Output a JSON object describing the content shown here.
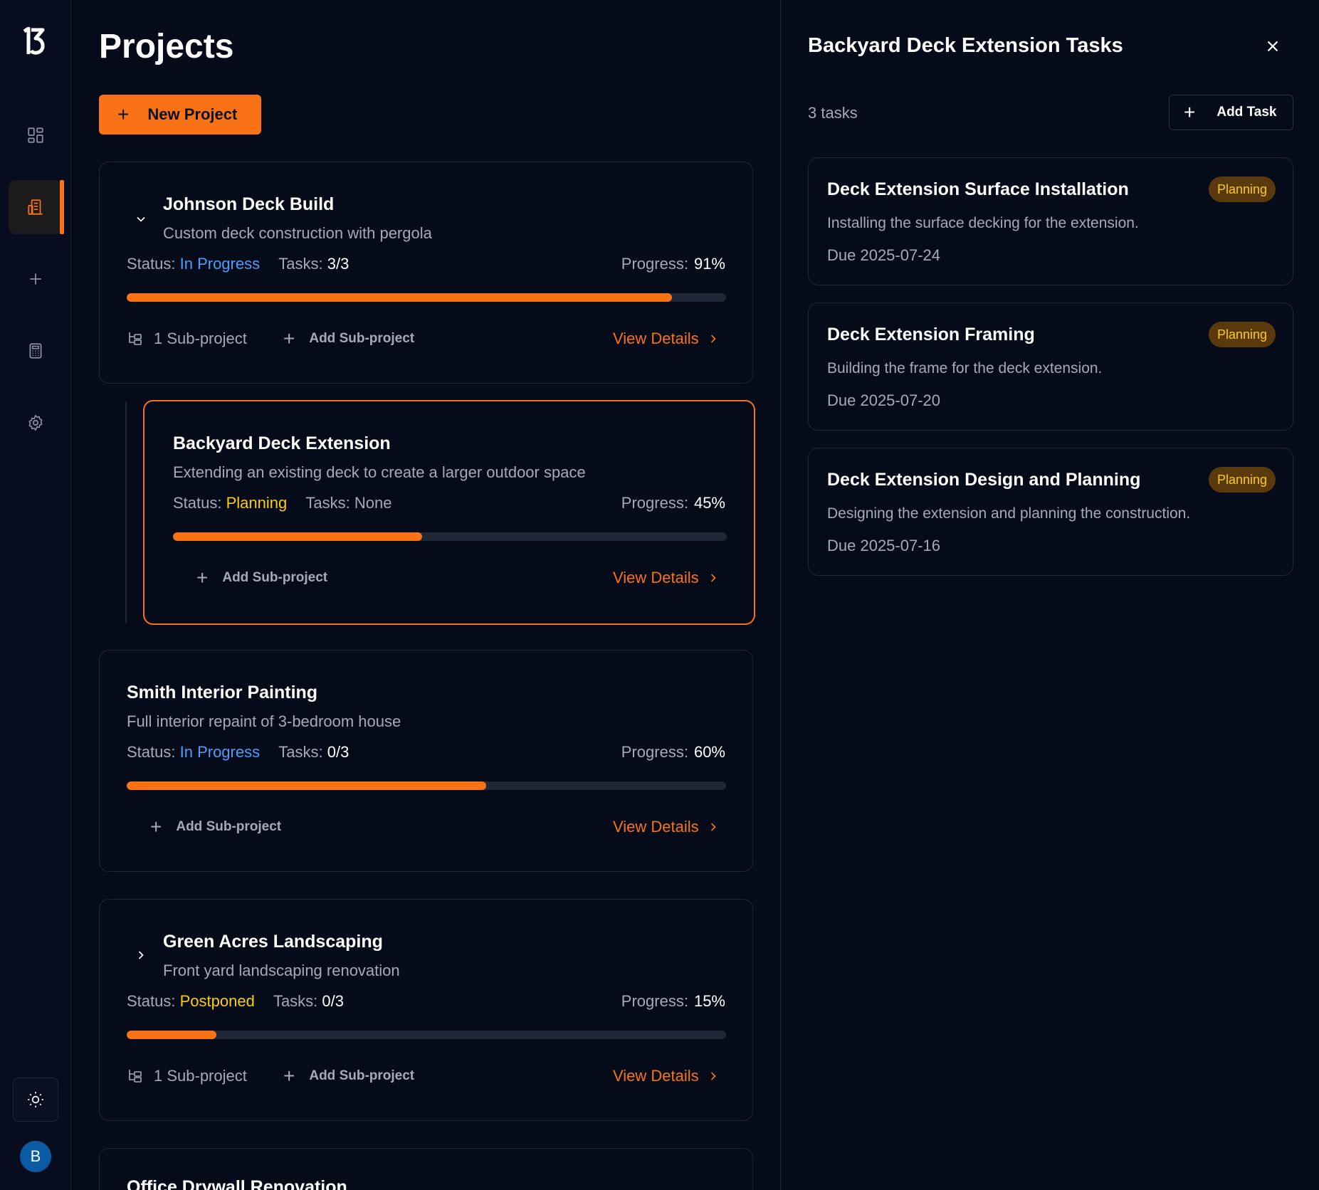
{
  "sidebar": {
    "logo": "B",
    "avatar": "B"
  },
  "main": {
    "title": "Projects",
    "new_project_label": "New Project",
    "projects": [
      {
        "title": "Johnson Deck Build",
        "description": "Custom deck construction with pergola",
        "status_label": "Status:",
        "status": "In Progress",
        "tasks_label": "Tasks:",
        "tasks": "3/3",
        "progress_label": "Progress:",
        "progress": "91%",
        "progress_value": 0.91,
        "sub_count": "1 Sub-project",
        "add_sub": "Add Sub-project",
        "view_details": "View Details"
      },
      {
        "title": "Backyard Deck Extension",
        "description": "Extending an existing deck to create a larger outdoor space",
        "status_label": "Status:",
        "status": "Planning",
        "tasks_label": "Tasks:",
        "tasks": "None",
        "progress_label": "Progress:",
        "progress": "45%",
        "progress_value": 0.45,
        "add_sub": "Add Sub-project",
        "view_details": "View Details"
      },
      {
        "title": "Smith Interior Painting",
        "description": "Full interior repaint of 3-bedroom house",
        "status_label": "Status:",
        "status": "In Progress",
        "tasks_label": "Tasks:",
        "tasks": "0/3",
        "progress_label": "Progress:",
        "progress": "60%",
        "progress_value": 0.6,
        "add_sub": "Add Sub-project",
        "view_details": "View Details"
      },
      {
        "title": "Green Acres Landscaping",
        "description": "Front yard landscaping renovation",
        "status_label": "Status:",
        "status": "Postponed",
        "tasks_label": "Tasks:",
        "tasks": "0/3",
        "progress_label": "Progress:",
        "progress": "15%",
        "progress_value": 0.15,
        "sub_count": "1 Sub-project",
        "add_sub": "Add Sub-project",
        "view_details": "View Details"
      },
      {
        "title": "Office Drywall Renovation"
      }
    ]
  },
  "panel": {
    "title": "Backyard Deck Extension Tasks",
    "task_count": "3 tasks",
    "add_task_label": "Add Task",
    "tasks": [
      {
        "title": "Deck Extension Surface Installation",
        "badge": "Planning",
        "description": "Installing the surface decking for the extension.",
        "due": "Due 2025-07-24"
      },
      {
        "title": "Deck Extension Framing",
        "badge": "Planning",
        "description": "Building the frame for the deck extension.",
        "due": "Due 2025-07-20"
      },
      {
        "title": "Deck Extension Design and Planning",
        "badge": "Planning",
        "description": "Designing the extension and planning the construction.",
        "due": "Due 2025-07-16"
      }
    ]
  },
  "colors": {
    "accent": "#f97316",
    "in_progress": "#4f9cf9",
    "planning": "#facc15",
    "postponed": "#facc15",
    "background": "#060b1a"
  }
}
